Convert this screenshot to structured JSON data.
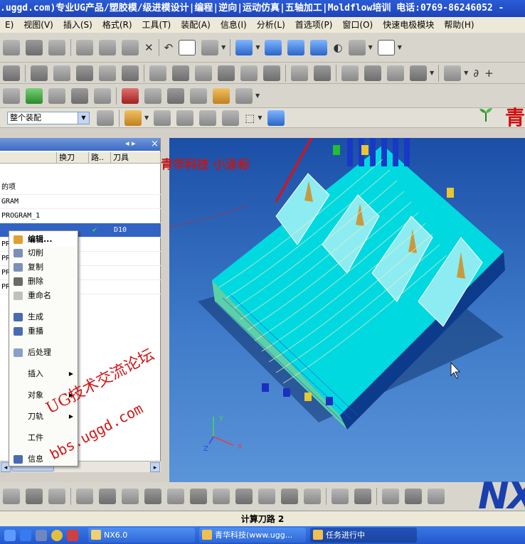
{
  "titlebar": {
    "text": ".uggd.com)专业UG产品/塑胶模/级进模设计|编程|逆向|运动仿真|五轴加工|Moldflow培训 电话:0769-86246052 -"
  },
  "menu": {
    "items": [
      "E)",
      "视图(V)",
      "插入(S)",
      "格式(R)",
      "工具(T)",
      "装配(A)",
      "信息(I)",
      "分析(L)",
      "首选项(P)",
      "窗口(O)",
      "快速电极模块",
      "帮助(H)"
    ]
  },
  "assembly_select": {
    "value": "整个装配"
  },
  "brand_right": "青",
  "navigator": {
    "columns": [
      "",
      "换刀",
      "路..",
      "刀具"
    ],
    "rows": [
      {
        "name": "的项",
        "tool": "",
        "check": ""
      },
      {
        "name": "GRAM",
        "tool": "",
        "check": ""
      },
      {
        "name": "PROGRAM_1",
        "tool": "",
        "check": ""
      },
      {
        "name": "",
        "tool": "D10",
        "check": "✔",
        "selected": true
      },
      {
        "name": "PR",
        "tool": "",
        "check": ""
      },
      {
        "name": "PR",
        "tool": "",
        "check": ""
      },
      {
        "name": "PR",
        "tool": "",
        "check": ""
      },
      {
        "name": "PR",
        "tool": "",
        "check": ""
      }
    ],
    "close_glyph": "×",
    "min_glyph": "◂ ▸"
  },
  "context_menu": {
    "items": [
      {
        "label": "编辑...",
        "icon": "edit-icon"
      },
      {
        "label": "切削",
        "icon": "cut-icon"
      },
      {
        "label": "复制",
        "icon": "copy-icon"
      },
      {
        "label": "删除",
        "icon": "delete-icon"
      },
      {
        "label": "重命名",
        "icon": "rename-icon"
      },
      {
        "label": "生成",
        "icon": "generate-icon"
      },
      {
        "label": "重播",
        "icon": "replay-icon"
      },
      {
        "label": "后处理",
        "icon": "postprocess-icon"
      },
      {
        "label": "插入",
        "icon": "",
        "submenu": true
      },
      {
        "label": "对象",
        "icon": "",
        "submenu": true
      },
      {
        "label": "刀轨",
        "icon": "",
        "submenu": true
      },
      {
        "label": "工件",
        "icon": ""
      },
      {
        "label": "信息",
        "icon": "info-icon"
      }
    ]
  },
  "watermarks": {
    "top": "青华科技 小泳标",
    "diagonal": "UG技术交流论坛",
    "url": "bbs.uggd.com"
  },
  "axis_labels": {
    "x": "X",
    "y": "Y",
    "z": "Z"
  },
  "status": {
    "text": "计算刀路 2"
  },
  "nx_logo": "NX",
  "taskbar": {
    "tasks": [
      {
        "label": "NX6.0",
        "active": false
      },
      {
        "label": "青华科技(www.ugg...",
        "active": false
      },
      {
        "label": "任务进行中",
        "active": true
      }
    ]
  },
  "colors": {
    "graphics_bg": "#2e66bd",
    "toolpath": "#00e5e5",
    "accent_red": "#d01010",
    "selection": "#3163c5"
  }
}
